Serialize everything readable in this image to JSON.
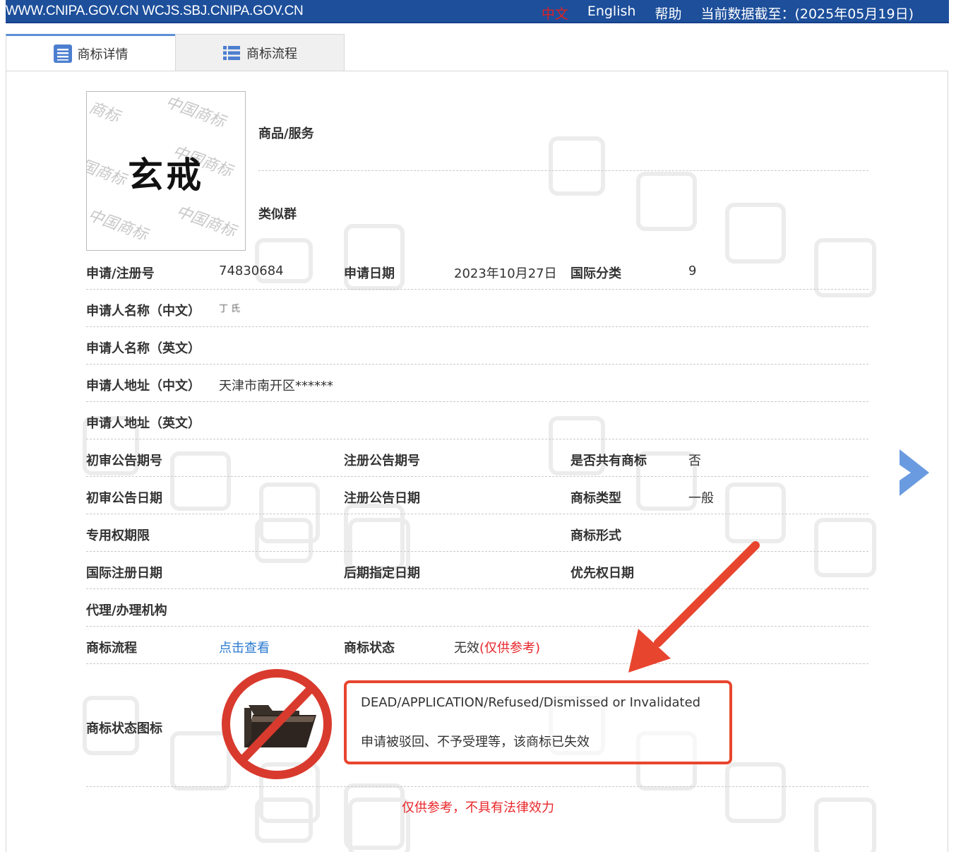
{
  "header": {
    "site_urls": "WWW.CNIPA.GOV.CN WCJS.SBJ.CNIPA.GOV.CN",
    "lang_zh": "中文",
    "lang_en": "English",
    "help": "帮助",
    "data_date": "当前数据截至：(2025年05月19日)"
  },
  "tabs": [
    {
      "label": "商标详情",
      "active": true,
      "icon": "document-list-icon"
    },
    {
      "label": "商标流程",
      "active": false,
      "icon": "list-icon"
    }
  ],
  "mark": {
    "text": "玄戒",
    "watermark": "中国商标"
  },
  "fields": {
    "goods_services": {
      "label": "商品/服务",
      "value": ""
    },
    "similar_group": {
      "label": "类似群",
      "value": ""
    },
    "reg_no": {
      "label": "申请/注册号",
      "value": "74830684"
    },
    "app_date": {
      "label": "申请日期",
      "value": "2023年10月27日"
    },
    "intl_class": {
      "label": "国际分类",
      "value": "9"
    },
    "applicant_zh": {
      "label": "申请人名称（中文）",
      "value": "丁 氏"
    },
    "applicant_en": {
      "label": "申请人名称（英文）",
      "value": ""
    },
    "address_zh": {
      "label": "申请人地址（中文）",
      "value": "天津市南开区******"
    },
    "address_en": {
      "label": "申请人地址（英文）",
      "value": ""
    },
    "prelim_pub_no": {
      "label": "初审公告期号",
      "value": ""
    },
    "reg_pub_no": {
      "label": "注册公告期号",
      "value": ""
    },
    "shared": {
      "label": "是否共有商标",
      "value": "否"
    },
    "prelim_pub_date": {
      "label": "初审公告日期",
      "value": ""
    },
    "reg_pub_date": {
      "label": "注册公告日期",
      "value": ""
    },
    "mark_type": {
      "label": "商标类型",
      "value": "一般"
    },
    "exclusive_period": {
      "label": "专用权期限",
      "value": ""
    },
    "mark_form": {
      "label": "商标形式",
      "value": ""
    },
    "intl_reg_date": {
      "label": "国际注册日期",
      "value": ""
    },
    "later_desig_date": {
      "label": "后期指定日期",
      "value": ""
    },
    "priority_date": {
      "label": "优先权日期",
      "value": ""
    },
    "agent": {
      "label": "代理/办理机构",
      "value": ""
    },
    "process": {
      "label": "商标流程",
      "value": "点击查看"
    },
    "status": {
      "label": "商标状态",
      "value": "无效",
      "note": "(仅供参考)"
    },
    "status_icon": {
      "label": "商标状态图标"
    }
  },
  "status_box": {
    "en": "DEAD/APPLICATION/Refused/Dismissed or Invalidated",
    "zh": "申请被驳回、不予受理等，该商标已失效"
  },
  "footer_note": "仅供参考，不具有法律效力",
  "colors": {
    "header_bg": "#1d4f9b",
    "link": "#2a7ad0",
    "alert_red": "#e8262a",
    "arrow_red": "#e8452f",
    "next_arrow": "#6a9be0"
  }
}
